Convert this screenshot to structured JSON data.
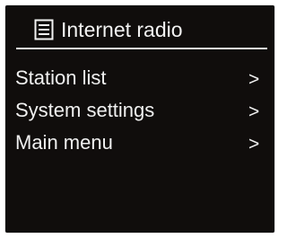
{
  "header": {
    "icon": "list-icon",
    "title": "Internet radio"
  },
  "menu": {
    "items": [
      {
        "label": "Station list",
        "arrow": ">"
      },
      {
        "label": "System settings",
        "arrow": ">"
      },
      {
        "label": "Main menu",
        "arrow": ">"
      }
    ]
  },
  "colors": {
    "screen_background": "#100d0c",
    "text": "#f0f0f0"
  }
}
